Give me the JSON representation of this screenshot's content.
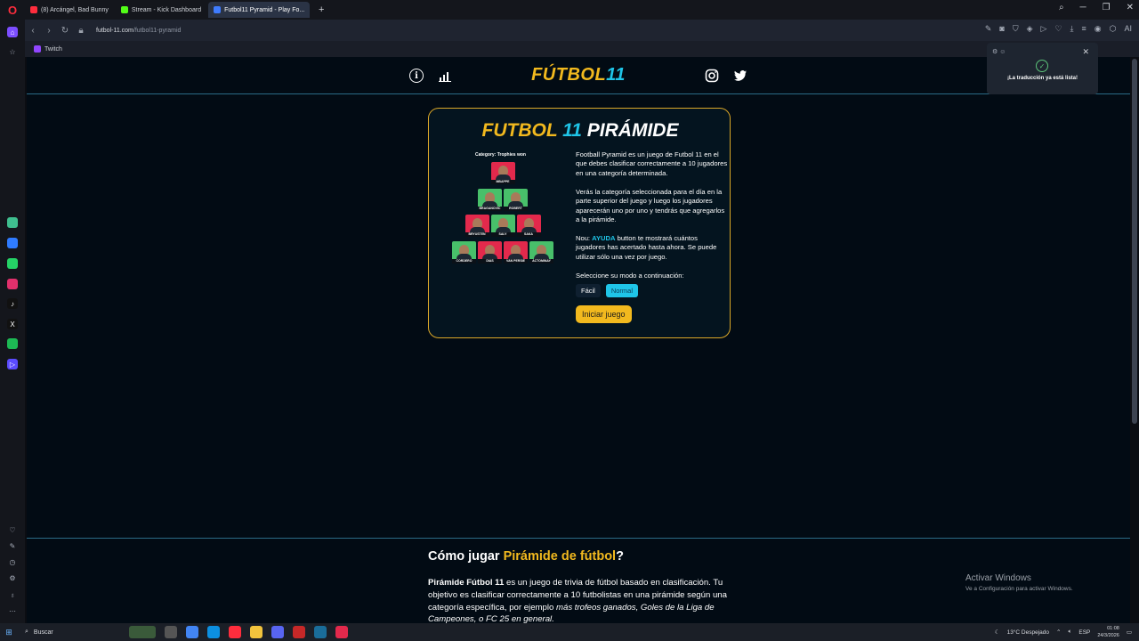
{
  "browser": {
    "tabs": [
      {
        "label": "(8) Arcángel, Bad Bunny",
        "color": "#ff2d3d"
      },
      {
        "label": "Stream - Kick Dashboard",
        "color": "#53fc18"
      },
      {
        "label": "Futbol11 Pyramid - Play Fo...",
        "color": "#3f7cff",
        "active": true
      }
    ],
    "url_host": "futbol-11.com",
    "url_path": "/futbol11-pyramid",
    "bookmark": "Twitch"
  },
  "site": {
    "logo_text": "FÚTBOL",
    "logo_num": "11",
    "info_icon_glyph": "i"
  },
  "card": {
    "title_part1": "FUTBOL",
    "title_num": "11",
    "title_part2": "PIRÁMIDE",
    "category_label": "Category: Trophies won",
    "players": [
      {
        "name": "MBAPPE",
        "color": "red"
      },
      {
        "name": "BRAGANOVIC",
        "color": "green"
      },
      {
        "name": "ROBERT",
        "color": "green"
      },
      {
        "name": "BRYUSTEN",
        "color": "red"
      },
      {
        "name": "SALY",
        "color": "green"
      },
      {
        "name": "SAKA",
        "color": "red"
      },
      {
        "name": "CORDERO",
        "color": "green"
      },
      {
        "name": "DIAS",
        "color": "red"
      },
      {
        "name": "VAN PERSIE",
        "color": "red"
      },
      {
        "name": "ACTOMINAY",
        "color": "green"
      }
    ],
    "para1": "Football Pyramid es un juego de Futbol 11 en el que debes clasificar correctamente a 10 jugadores en una categoría determinada.",
    "para2": "Verás la categoría seleccionada para el día en la parte superior del juego y luego los jugadores aparecerán uno por uno y tendrás que agregarlos a la pirámide.",
    "para3_prefix": "Nou:",
    "para3_help": "AYUDA",
    "para3_suffix": "button te mostrará cuántos jugadores has acertado hasta ahora. Se puede utilizar sólo una vez por juego.",
    "mode_prompt": "Seleccione su modo a continuación:",
    "mode_easy": "Fácil",
    "mode_normal": "Normal",
    "start_label": "Iniciar juego"
  },
  "howto": {
    "title_prefix": "Cómo jugar",
    "title_highlight": "Pirámide de fútbol",
    "title_suffix": "?",
    "bold_lead": "Pirámide Fútbol 11",
    "text1": " es un juego de trivia de fútbol basado en clasificación. Tu objetivo es clasificar correctamente a 10 futbolistas en una pirámide según una categoría específica, por ejemplo ",
    "italic1": "más trofeos ganados, Goles de la Liga de Campeones, o FC 25 en general."
  },
  "translation_toast": {
    "message": "¡La traducción ya está lista!"
  },
  "windows_watermark": {
    "line1": "Activar Windows",
    "line2": "Ve a Configuración para activar Windows."
  },
  "taskbar": {
    "search_label": "Buscar",
    "weather": "13°C  Despejado",
    "lang": "ESP",
    "time": "01:08",
    "date": "24/3/2026"
  }
}
